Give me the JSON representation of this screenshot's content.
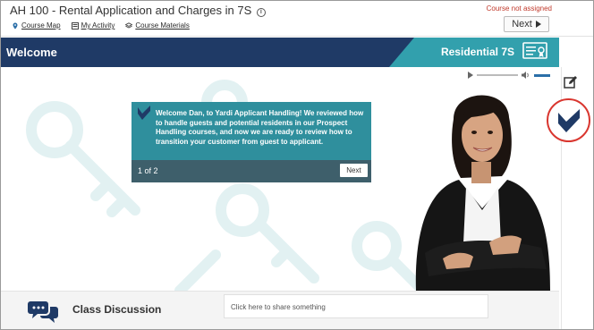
{
  "header": {
    "course_title": "AH 100 - Rental Application and Charges in 7S",
    "info_icon": "i",
    "status": "Course not assigned",
    "next_label": "Next",
    "nav_links": [
      {
        "label": "Course Map",
        "icon": "map-pin-icon"
      },
      {
        "label": "My Activity",
        "icon": "activity-icon"
      },
      {
        "label": "Course Materials",
        "icon": "layers-icon"
      }
    ]
  },
  "banner": {
    "title": "Welcome",
    "right_label": "Residential 7S",
    "icon": "certificate-icon",
    "colors": {
      "navy": "#1f3a66",
      "teal": "#32a0ad"
    }
  },
  "audio": {
    "play_icon": "play-icon",
    "volume_icon": "speaker-icon"
  },
  "dialog": {
    "message": "Welcome Dan, to Yardi Applicant Handling! We reviewed how to handle guests and potential residents in our Prospect Handling courses, and now we are ready to review how to transition your customer from guest to applicant.",
    "page_indicator": "1 of 2",
    "next_label": "Next",
    "colors": {
      "body": "#2f8f9d",
      "footer": "#3e5f6b"
    }
  },
  "discussion": {
    "label": "Class Discussion",
    "placeholder": "Click here to share something",
    "icon": "chat-bubbles-icon"
  },
  "sidebar": {
    "notes_icon": "edit-note-icon",
    "yardi_icon": "yardi-logo-icon",
    "highlight_color": "#d9362f"
  }
}
